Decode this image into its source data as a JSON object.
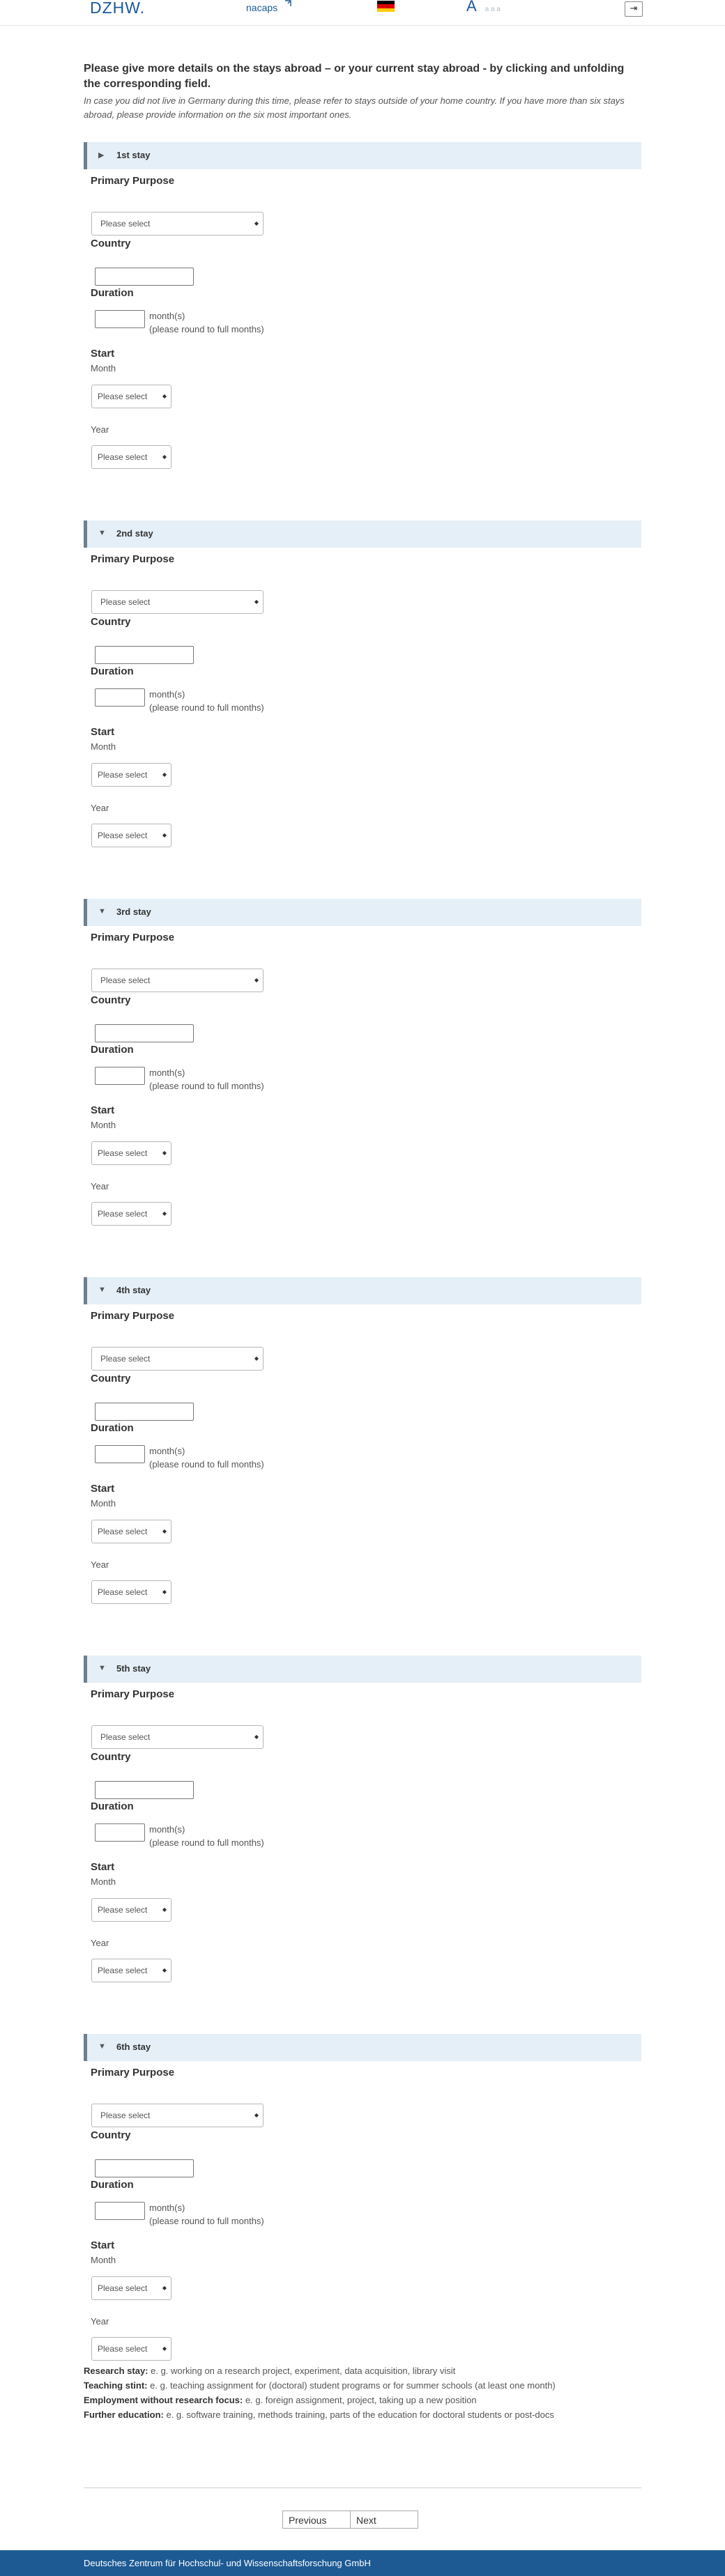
{
  "header": {
    "logo_dzhw": "DZHW.",
    "logo_nacaps": "nacaps",
    "font_big": "A",
    "font_small": "a   a   a",
    "exit_icon_label": "⇥"
  },
  "intro": {
    "title": "Please give more details on the stays abroad – or your current stay abroad - by clicking and unfolding the corresponding field.",
    "note": "In case you did not live in Germany during this time, please refer to stays outside of your home country. If you have more than six stays abroad, please provide information on the six most important ones."
  },
  "field_labels": {
    "purpose": "Primary Purpose",
    "country": "Country",
    "duration": "Duration",
    "unit_line1": "month(s)",
    "unit_line2": "(please round to full months)",
    "start": "Start",
    "month": "Month",
    "year": "Year"
  },
  "stays": [
    {
      "title": "1st stay",
      "arrow": "▶",
      "purpose_value": "Please select",
      "month_value": "Please select",
      "year_value": "Please select"
    },
    {
      "title": "2nd stay",
      "arrow": "▼",
      "purpose_value": "Please select",
      "month_value": "Please select",
      "year_value": "Please select"
    },
    {
      "title": "3rd stay",
      "arrow": "▼",
      "purpose_value": "Please select",
      "month_value": "Please select",
      "year_value": "Please select"
    },
    {
      "title": "4th stay",
      "arrow": "▼",
      "purpose_value": "Please select",
      "month_value": "Please select",
      "year_value": "Please select"
    },
    {
      "title": "5th stay",
      "arrow": "▼",
      "purpose_value": "Please select",
      "month_value": "Please select",
      "year_value": "Please select"
    },
    {
      "title": "6th stay",
      "arrow": "▼",
      "purpose_value": "Please select",
      "month_value": "Please select",
      "year_value": "Please select"
    }
  ],
  "definitions": [
    {
      "term": "Research stay:",
      "text": "e. g. working on a research project, experiment, data acquisition, library visit"
    },
    {
      "term": "Teaching stint:",
      "text": "e. g. teaching assignment for (doctoral) student programs or for summer schools (at least one month)"
    },
    {
      "term": "Employment without research focus:",
      "text": "e. g. foreign assignment, project, taking up a new position"
    },
    {
      "term": "Further education:",
      "text": "e. g. software training, methods training, parts of the education for doctoral students or post-docs"
    }
  ],
  "nav": {
    "previous": "Previous",
    "next": "Next"
  },
  "footer": {
    "text": "Deutsches Zentrum für Hochschul- und Wissenschaftsforschung GmbH"
  },
  "colors": {
    "accent": "#1d5a94",
    "stay_header_bg": "#e4eff7"
  }
}
